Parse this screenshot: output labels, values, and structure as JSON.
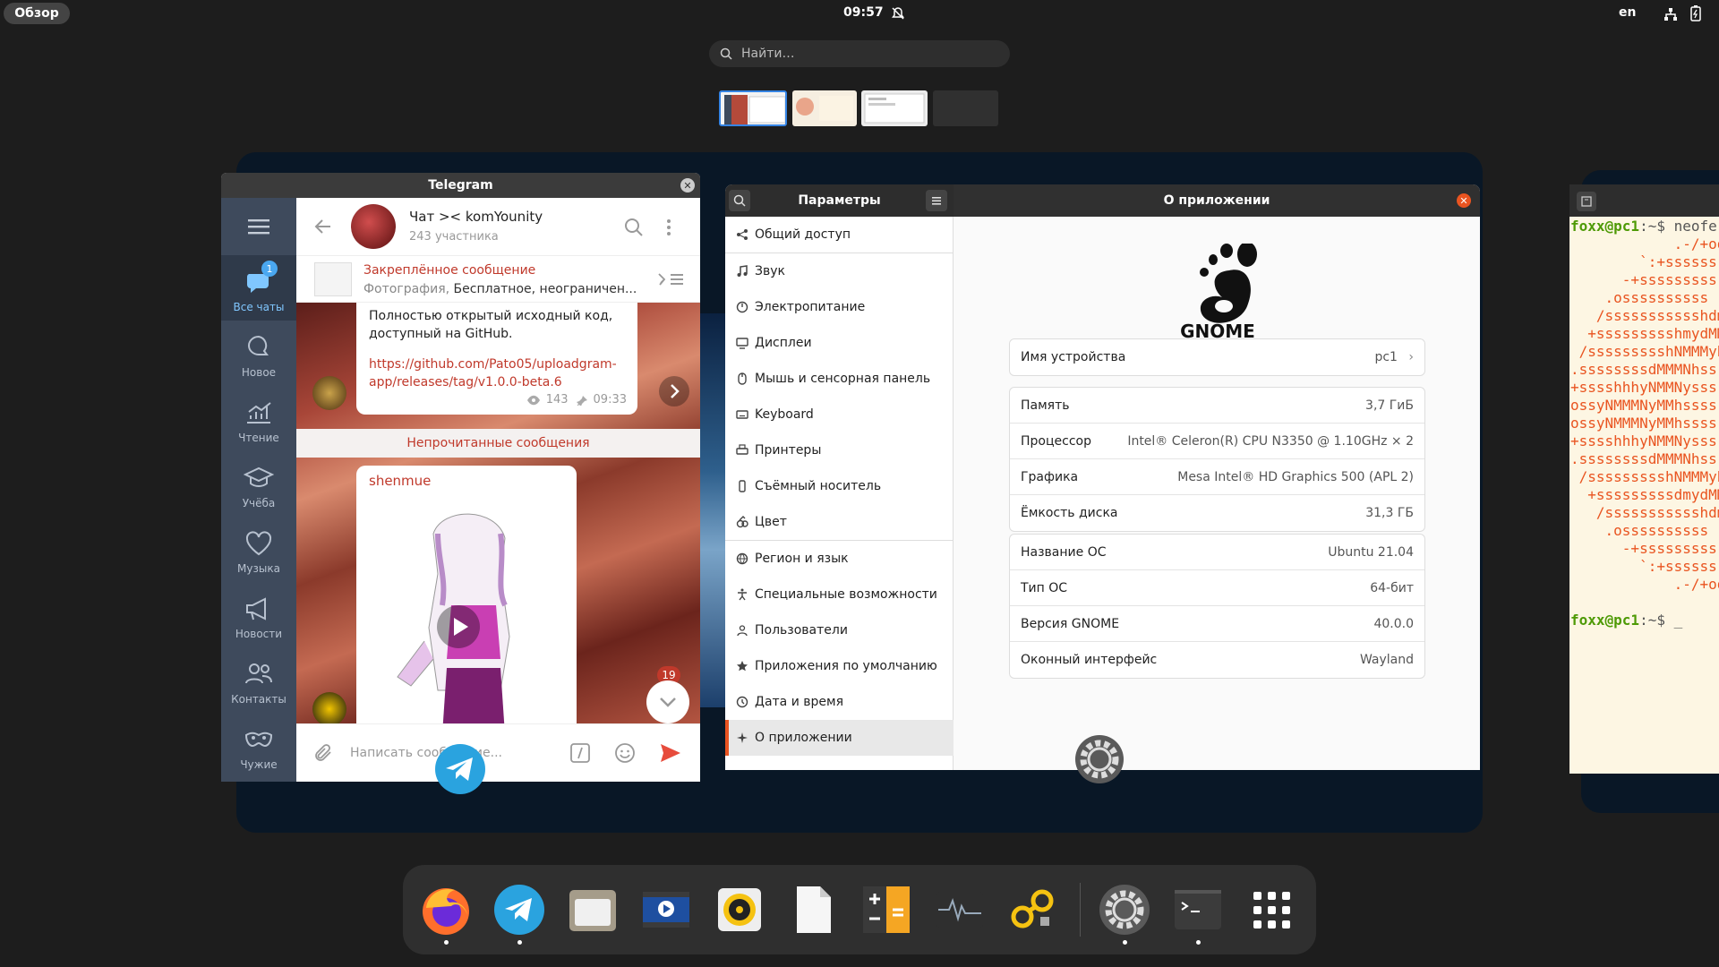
{
  "topbar": {
    "overview_label": "Обзор",
    "clock": "09:57",
    "language": "en"
  },
  "search": {
    "placeholder": "Найти…"
  },
  "telegram": {
    "window_title": "Telegram",
    "folders": [
      {
        "label": "Все чаты",
        "badge": "1"
      },
      {
        "label": "Новое"
      },
      {
        "label": "Чтение"
      },
      {
        "label": "Учёба"
      },
      {
        "label": "Музыка"
      },
      {
        "label": "Новости"
      },
      {
        "label": "Контакты"
      },
      {
        "label": "Чужие"
      }
    ],
    "chat_title": "Чат >< komYounity",
    "chat_subtitle": "243 участника",
    "pinned_title": "Закреплённое сообщение",
    "pinned_prefix": "Фотография,",
    "pinned_text": " Бесплатное, неограничен...",
    "msg1_text": "Полностью открытый исходный код, доступный на GitHub.",
    "msg1_link": "https://github.com/Pato05/uploadgram-app/releases/tag/v1.0.0-beta.6",
    "msg1_views": "143",
    "msg1_time": "09:33",
    "unread_bar": "Непрочитанные сообщения",
    "msg2_sender": "shenmue",
    "unread_count": "19",
    "composer_placeholder": "Написать сообщение..."
  },
  "settings": {
    "title": "Параметры",
    "page_title": "О приложении",
    "sidebar": [
      {
        "label": "Общий доступ",
        "icon": "share-icon"
      },
      {
        "label": "Звук",
        "icon": "music-note-icon"
      },
      {
        "label": "Электропитание",
        "icon": "power-icon"
      },
      {
        "label": "Дисплеи",
        "icon": "display-icon"
      },
      {
        "label": "Мышь и сенсорная панель",
        "icon": "mouse-icon"
      },
      {
        "label": "Keyboard",
        "icon": "keyboard-icon"
      },
      {
        "label": "Принтеры",
        "icon": "printer-icon"
      },
      {
        "label": "Съёмный носитель",
        "icon": "usb-icon"
      },
      {
        "label": "Цвет",
        "icon": "color-icon"
      },
      {
        "label": "Регион и язык",
        "icon": "globe-icon"
      },
      {
        "label": "Специальные возможности",
        "icon": "accessibility-icon"
      },
      {
        "label": "Пользователи",
        "icon": "users-icon"
      },
      {
        "label": "Приложения по умолчанию",
        "icon": "star-icon"
      },
      {
        "label": "Дата и время",
        "icon": "clock-icon"
      },
      {
        "label": "О приложении",
        "icon": "sparkle-icon"
      }
    ],
    "logo_text": "GNOME",
    "device_name_label": "Имя устройства",
    "device_name_value": "pc1",
    "hardware": [
      {
        "k": "Память",
        "v": "3,7 ГиБ"
      },
      {
        "k": "Процессор",
        "v": "Intel® Celeron(R) CPU N3350 @ 1.10GHz × 2"
      },
      {
        "k": "Графика",
        "v": "Mesa Intel® HD Graphics 500 (APL 2)"
      },
      {
        "k": "Ёмкость диска",
        "v": "31,3 ГБ"
      }
    ],
    "os": [
      {
        "k": "Название ОС",
        "v": "Ubuntu 21.04"
      },
      {
        "k": "Тип ОС",
        "v": "64-бит"
      },
      {
        "k": "Версия GNOME",
        "v": "40.0.0"
      },
      {
        "k": "Оконный интерфейс",
        "v": "Wayland"
      }
    ]
  },
  "terminal": {
    "prompt": "foxx@pc1",
    "path": ":~$",
    "command": " neofe",
    "art": [
      "            .-/+oo",
      "        `:+ssssss",
      "      -+sssssssss",
      "    .ossssssssss",
      "   /ssssssssssshdm",
      "  +ssssssssshmydMM",
      " /ssssssssshNMMMyh",
      ".ssssssssdMMMNhss",
      "+sssshhhyNMMNysss",
      "ossyNMMMNyMMhssss",
      "ossyNMMMNyMMhssss",
      "+sssshhhyNMMNysss",
      ".ssssssssdMMMNhss",
      " /ssssssssshNMMMyh",
      "  +sssssssssdmydMM",
      "   /ssssssssssshdm",
      "    .ossssssssss",
      "      -+sssssssss",
      "        `:+ssssss",
      "            .-/+oo"
    ],
    "cursor": " _"
  },
  "dock": [
    {
      "name": "firefox",
      "running": true
    },
    {
      "name": "telegram",
      "running": true
    },
    {
      "name": "files",
      "running": false
    },
    {
      "name": "video-editor",
      "running": false
    },
    {
      "name": "rhythmbox",
      "running": false
    },
    {
      "name": "text-editor",
      "running": false
    },
    {
      "name": "calculator",
      "running": false
    },
    {
      "name": "system-monitor",
      "running": false
    },
    {
      "name": "sound-settings",
      "running": false
    },
    {
      "name": "settings",
      "running": true
    },
    {
      "name": "terminal",
      "running": true
    },
    {
      "name": "app-grid",
      "running": false
    }
  ],
  "colors": {
    "accent": "#e95420",
    "selection": "#3584e4",
    "telegram_red": "#c0392b",
    "telegram_blue": "#4aa7f0"
  }
}
